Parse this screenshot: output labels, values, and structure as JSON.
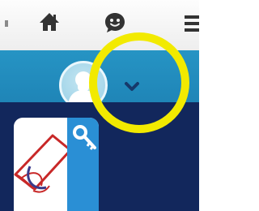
{
  "toolbar": {
    "buttons": [
      {
        "name": "home",
        "icon": "home-icon"
      },
      {
        "name": "chat",
        "icon": "smiley-chat-icon"
      },
      {
        "name": "menu",
        "icon": "hamburger-menu-icon"
      }
    ],
    "icon_color": "#333333"
  },
  "header": {
    "background": "#2390c1",
    "user_avatar_icon": "user-silhouette-icon",
    "dropdown_icon": "chevron-down-icon"
  },
  "annotation": {
    "shape": "circle",
    "color": "#f2ea00"
  },
  "content": {
    "background": "#12275c",
    "tile": {
      "icon": "document-key-icon",
      "ribbon_color": "#2a8fd5",
      "key_icon": "key-icon"
    }
  }
}
